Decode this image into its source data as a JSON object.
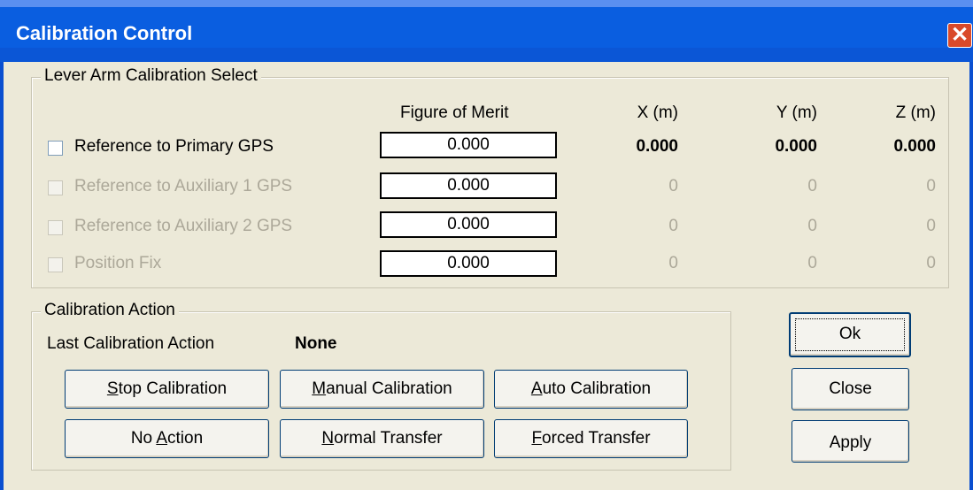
{
  "window": {
    "title": "Calibration Control",
    "close_glyph": "✕"
  },
  "lever": {
    "group_label": "Lever Arm Calibration Select",
    "headers": {
      "fom": "Figure of Merit",
      "x": "X (m)",
      "y": "Y (m)",
      "z": "Z (m)"
    },
    "rows": [
      {
        "label": "Reference to Primary GPS",
        "fom": "0.000",
        "x": "0.000",
        "y": "0.000",
        "z": "0.000",
        "enabled": true,
        "checked": false
      },
      {
        "label": "Reference to Auxiliary 1 GPS",
        "fom": "0.000",
        "x": "0",
        "y": "0",
        "z": "0",
        "enabled": false,
        "checked": false
      },
      {
        "label": "Reference to Auxiliary 2 GPS",
        "fom": "0.000",
        "x": "0",
        "y": "0",
        "z": "0",
        "enabled": false,
        "checked": false
      },
      {
        "label": "Position Fix",
        "fom": "0.000",
        "x": "0",
        "y": "0",
        "z": "0",
        "enabled": false,
        "checked": false
      }
    ]
  },
  "action": {
    "group_label": "Calibration Action",
    "last_label": "Last Calibration Action",
    "last_value": "None",
    "buttons": {
      "stop": {
        "pre": "",
        "mnemonic": "S",
        "post": "top Calibration"
      },
      "manual": {
        "pre": "",
        "mnemonic": "M",
        "post": "anual Calibration"
      },
      "auto": {
        "pre": "",
        "mnemonic": "A",
        "post": "uto Calibration"
      },
      "noaction": {
        "pre": "No ",
        "mnemonic": "A",
        "post": "ction"
      },
      "normal": {
        "pre": "",
        "mnemonic": "N",
        "post": "ormal Transfer"
      },
      "forced": {
        "pre": "",
        "mnemonic": "F",
        "post": "orced Transfer"
      }
    }
  },
  "dialog_buttons": {
    "ok": "Ok",
    "close": "Close",
    "apply": "Apply"
  },
  "colors": {
    "titlebar": "#0a5ee0",
    "dialog_bg": "#ece9d8",
    "disabled_text": "#aca899",
    "close_button": "#d94a2a"
  }
}
